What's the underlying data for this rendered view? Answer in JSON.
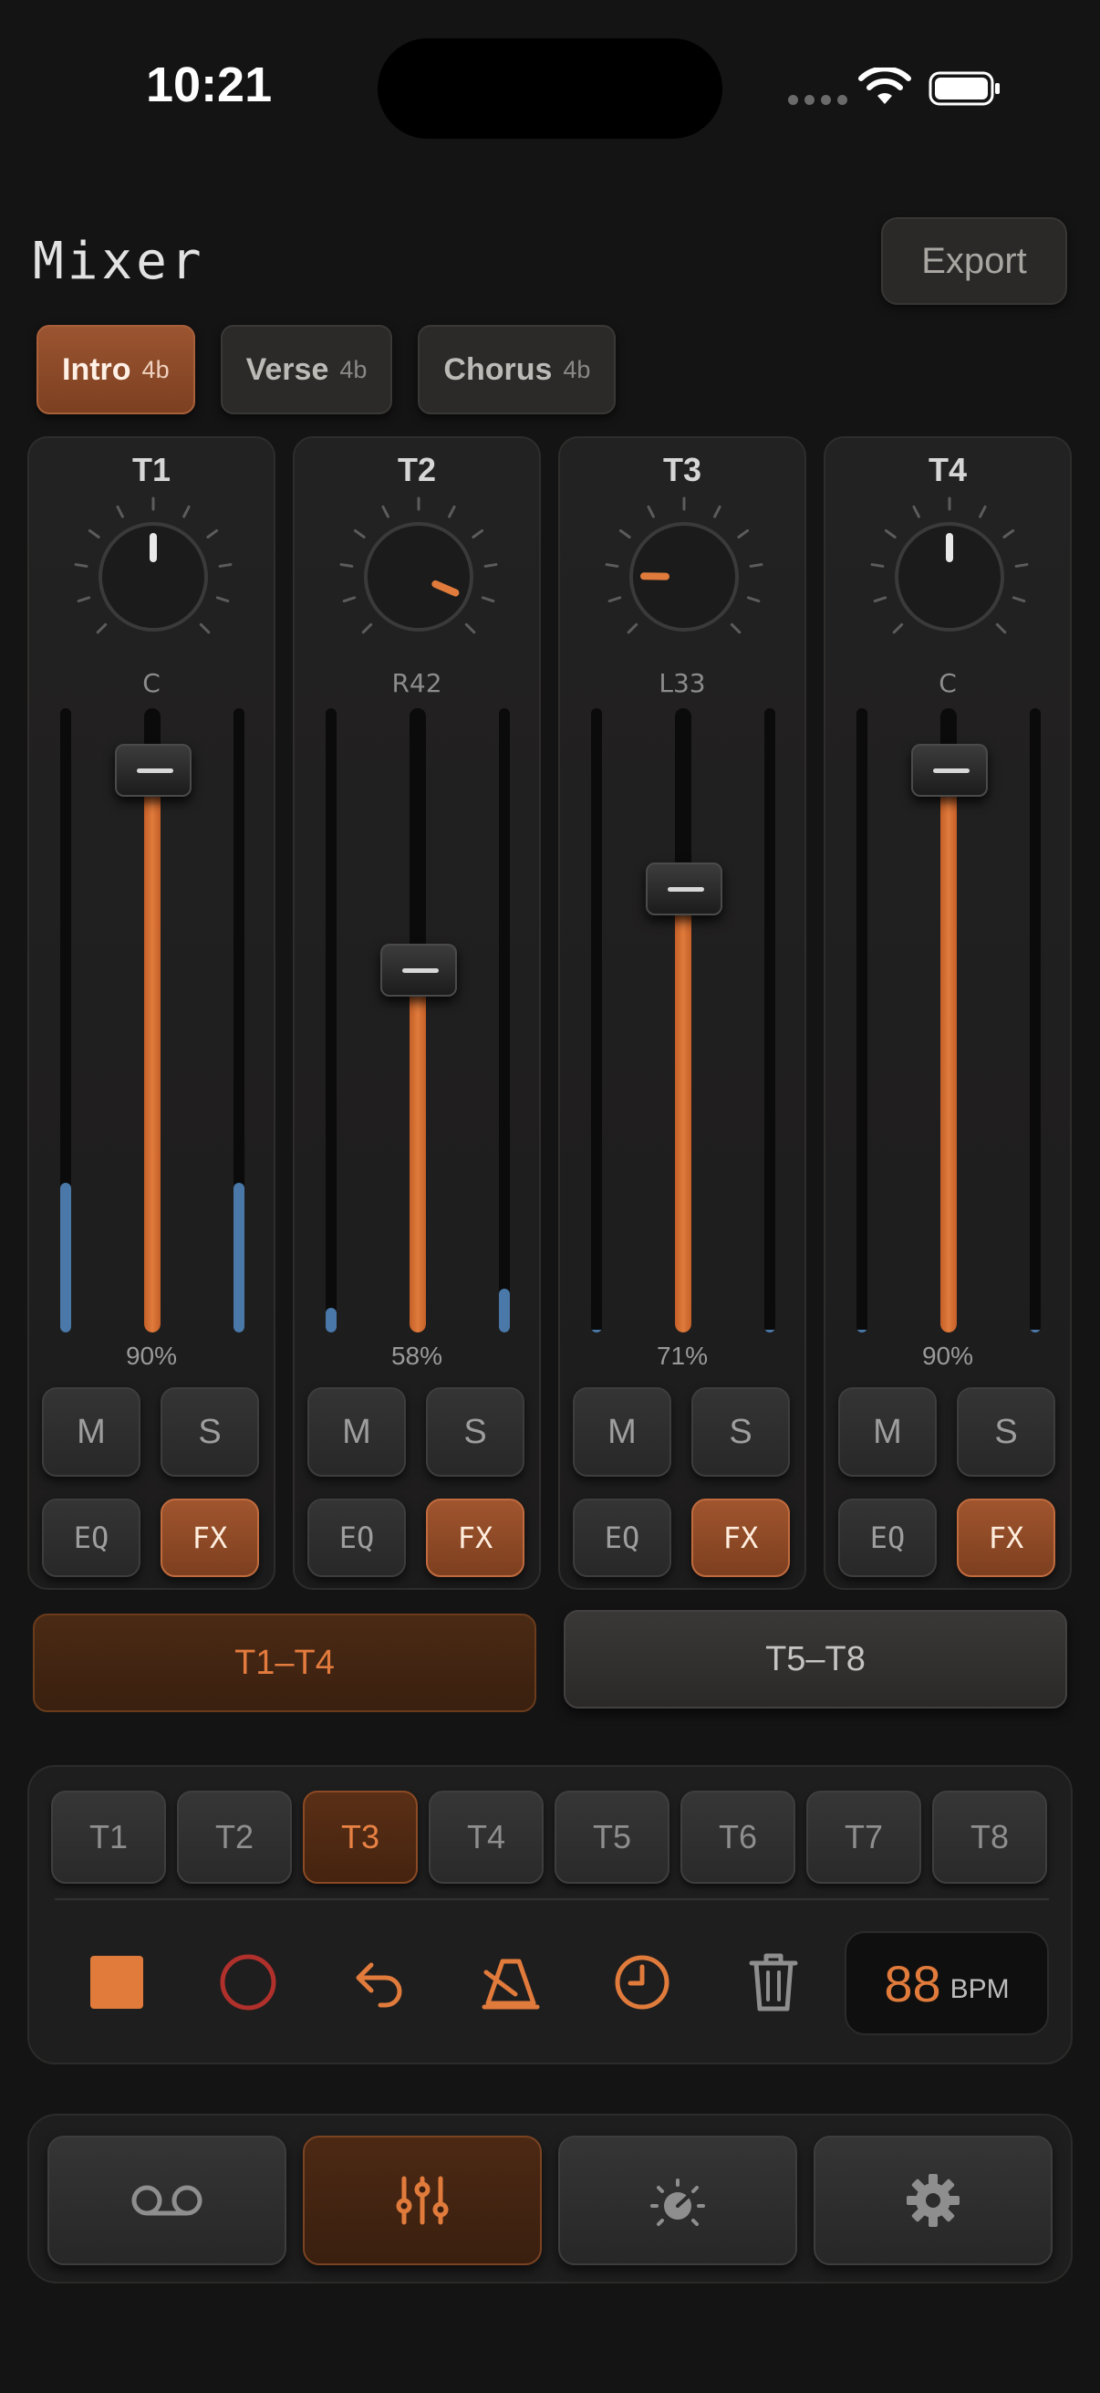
{
  "status": {
    "time": "10:21"
  },
  "header": {
    "title": "Mixer",
    "export_label": "Export"
  },
  "sections": [
    {
      "name": "Intro",
      "length": "4b",
      "active": true
    },
    {
      "name": "Verse",
      "length": "4b",
      "active": false
    },
    {
      "name": "Chorus",
      "length": "4b",
      "active": false
    }
  ],
  "channels": [
    {
      "name": "T1",
      "pan_label": "C",
      "pan": 0,
      "volume": 0.9,
      "volume_label": "90%",
      "meter_l": 0.24,
      "meter_r": 0.24,
      "mute": "M",
      "solo": "S",
      "eq": "EQ",
      "fx": "FX",
      "fx_on": true
    },
    {
      "name": "T2",
      "pan_label": "R42",
      "pan": 42,
      "volume": 0.58,
      "volume_label": "58%",
      "meter_l": 0.04,
      "meter_r": 0.07,
      "mute": "M",
      "solo": "S",
      "eq": "EQ",
      "fx": "FX",
      "fx_on": true
    },
    {
      "name": "T3",
      "pan_label": "L33",
      "pan": -33,
      "volume": 0.71,
      "volume_label": "71%",
      "meter_l": 0.0,
      "meter_r": 0.0,
      "mute": "M",
      "solo": "S",
      "eq": "EQ",
      "fx": "FX",
      "fx_on": true
    },
    {
      "name": "T4",
      "pan_label": "C",
      "pan": 0,
      "volume": 0.9,
      "volume_label": "90%",
      "meter_l": 0.0,
      "meter_r": 0.0,
      "mute": "M",
      "solo": "S",
      "eq": "EQ",
      "fx": "FX",
      "fx_on": true
    }
  ],
  "banks": {
    "active": "T1–T4",
    "other": "T5–T8"
  },
  "tracks": [
    "T1",
    "T2",
    "T3",
    "T4",
    "T5",
    "T6",
    "T7",
    "T8"
  ],
  "selected_track": "T3",
  "transport": {
    "icons": [
      "stop-icon",
      "record-icon",
      "undo-icon",
      "metronome-icon",
      "clock-icon",
      "trash-icon"
    ],
    "bpm": "88",
    "bpm_unit": "BPM"
  },
  "nav": {
    "icons": [
      "tape-icon",
      "mixer-sliders-icon",
      "effects-knob-icon",
      "settings-gear-icon"
    ],
    "active_index": 1
  },
  "colors": {
    "accent": "#e07b3c",
    "meter": "#4a78a8",
    "background": "#141414",
    "record": "#b0302c"
  }
}
